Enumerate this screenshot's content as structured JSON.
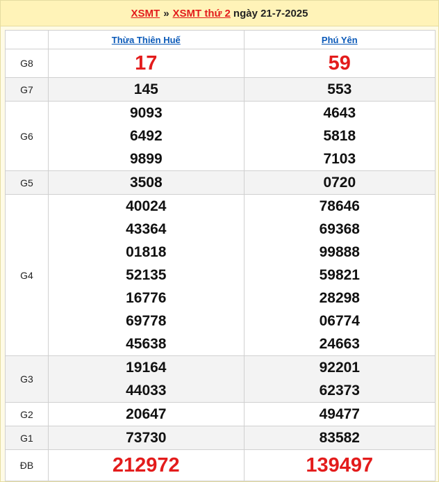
{
  "header": {
    "link1": "XSMT",
    "separator": "»",
    "link2": "XSMT thứ 2",
    "date_text": "ngày 21-7-2025"
  },
  "provinces": [
    "Thừa Thiên Huế",
    "Phú Yên"
  ],
  "rows": [
    {
      "label": "G8",
      "values": [
        [
          "17"
        ],
        [
          "59"
        ]
      ]
    },
    {
      "label": "G7",
      "values": [
        [
          "145"
        ],
        [
          "553"
        ]
      ]
    },
    {
      "label": "G6",
      "values": [
        [
          "9093",
          "6492",
          "9899"
        ],
        [
          "4643",
          "5818",
          "7103"
        ]
      ]
    },
    {
      "label": "G5",
      "values": [
        [
          "3508"
        ],
        [
          "0720"
        ]
      ]
    },
    {
      "label": "G4",
      "values": [
        [
          "40024",
          "43364",
          "01818",
          "52135",
          "16776",
          "69778",
          "45638"
        ],
        [
          "78646",
          "69368",
          "99888",
          "59821",
          "28298",
          "06774",
          "24663"
        ]
      ]
    },
    {
      "label": "G3",
      "values": [
        [
          "19164",
          "44033"
        ],
        [
          "92201",
          "62373"
        ]
      ]
    },
    {
      "label": "G2",
      "values": [
        [
          "20647"
        ],
        [
          "49477"
        ]
      ]
    },
    {
      "label": "G1",
      "values": [
        [
          "73730"
        ],
        [
          "83582"
        ]
      ]
    },
    {
      "label": "ĐB",
      "values": [
        [
          "212972"
        ],
        [
          "139497"
        ]
      ]
    }
  ]
}
